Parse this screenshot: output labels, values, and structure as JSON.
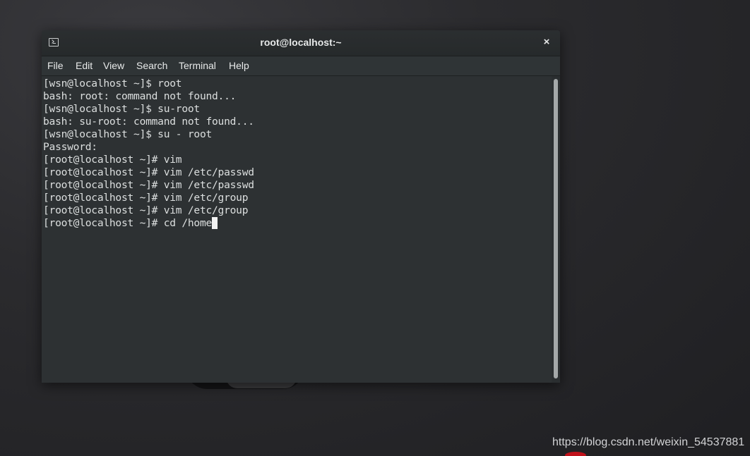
{
  "window": {
    "title": "root@localhost:~",
    "close_glyph": "×",
    "terminal_icon": "terminal-icon"
  },
  "menubar": {
    "items": [
      {
        "label": "File"
      },
      {
        "label": "Edit"
      },
      {
        "label": "View"
      },
      {
        "label": "Search"
      },
      {
        "label": "Terminal"
      },
      {
        "label": "Help"
      }
    ]
  },
  "terminal": {
    "lines": [
      "[wsn@localhost ~]$ root",
      "bash: root: command not found...",
      "[wsn@localhost ~]$ su-root",
      "bash: su-root: command not found...",
      "[wsn@localhost ~]$ su - root",
      "Password:",
      "[root@localhost ~]# vim",
      "[root@localhost ~]# vim /etc/passwd",
      "[root@localhost ~]# vim /etc/passwd",
      "[root@localhost ~]# vim /etc/group",
      "[root@localhost ~]# vim /etc/group",
      "[root@localhost ~]# cd /home"
    ]
  },
  "desktop": {
    "watermark": "https://blog.csdn.net/weixin_54537881"
  },
  "colors": {
    "terminal_bg": "#2d3133",
    "terminal_fg": "#dcdfdf",
    "titlebar_bg": "#2b2e30"
  }
}
